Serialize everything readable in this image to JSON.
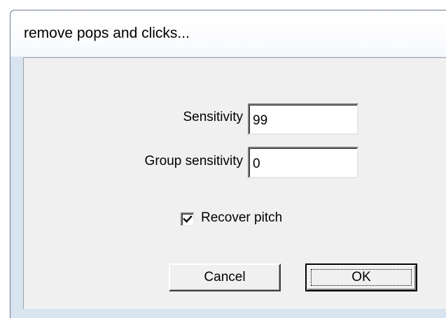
{
  "window": {
    "title": "remove pops and clicks..."
  },
  "form": {
    "sensitivity": {
      "label": "Sensitivity",
      "value": "99"
    },
    "group_sensitivity": {
      "label": "Group sensitivity",
      "value": "0"
    },
    "recover_pitch": {
      "label": "Recover pitch",
      "checked": true
    }
  },
  "buttons": {
    "cancel": "Cancel",
    "ok": "OK"
  },
  "colors": {
    "frame": "#d9e4f1",
    "client": "#f0f0f0",
    "titlebar": "#ffffff"
  },
  "icons": {
    "checkmark": "checkmark-icon"
  }
}
